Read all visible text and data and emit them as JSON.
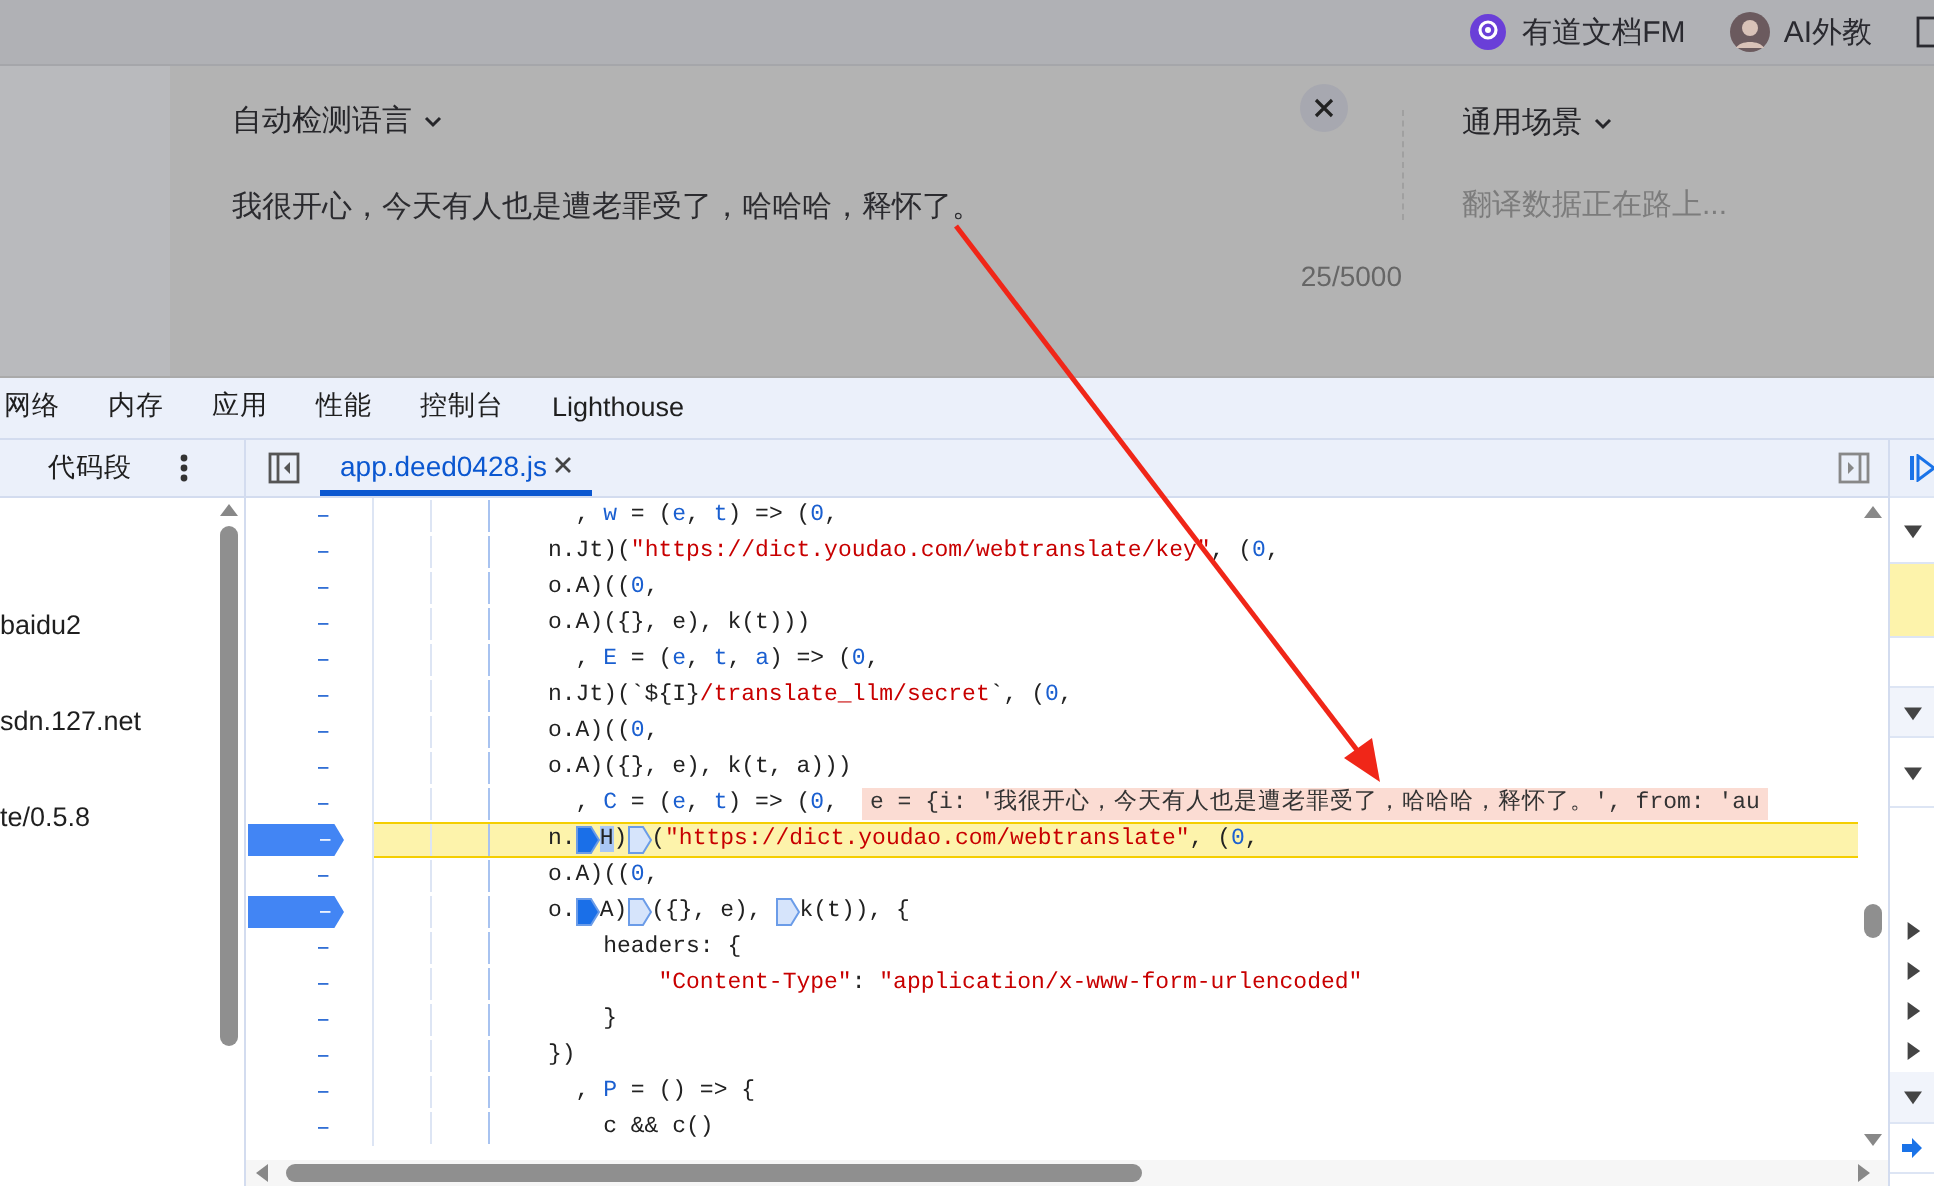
{
  "top_bar": {
    "items": [
      {
        "kind": "fm",
        "label": "有道文档FM"
      },
      {
        "kind": "avatar",
        "label": "AI外教"
      }
    ]
  },
  "translator": {
    "source_language": "自动检测语言",
    "source_text": "我很开心，今天有人也是遭老罪受了，哈哈哈，释怀了。",
    "char_count": "25/5000",
    "scene": "通用场景",
    "placeholder": "翻译数据正在路上..."
  },
  "devtools": {
    "tabs": [
      {
        "label": "网络",
        "selected": false
      },
      {
        "label": "内存",
        "selected": false
      },
      {
        "label": "应用",
        "selected": false
      },
      {
        "label": "性能",
        "selected": false
      },
      {
        "label": "控制台",
        "selected": false
      },
      {
        "label": "Lighthouse",
        "selected": false
      }
    ],
    "sidebar": {
      "title": "代码段",
      "items": [
        "baidu2",
        "sdn.127.net",
        "te/0.5.8"
      ]
    },
    "editor_tab": {
      "label": "app.deed0428.js",
      "selected": true
    },
    "lines": [
      {
        "gutter": "–",
        "breakpoint": false,
        "current": false,
        "tokens": [
          {
            "kind": "plain",
            "text": "  , "
          },
          {
            "kind": "ident",
            "text": "w"
          },
          {
            "kind": "plain",
            "text": " = ("
          },
          {
            "kind": "ident",
            "text": "e"
          },
          {
            "kind": "plain",
            "text": ", "
          },
          {
            "kind": "ident",
            "text": "t"
          },
          {
            "kind": "plain",
            "text": ") => ("
          },
          {
            "kind": "ident",
            "text": "0"
          },
          {
            "kind": "plain",
            "text": ","
          }
        ]
      },
      {
        "gutter": "–",
        "breakpoint": false,
        "current": false,
        "tokens": [
          {
            "kind": "plain",
            "text": "n.Jt)("
          },
          {
            "kind": "string",
            "text": "\"https://dict.youdao.com/webtranslate/key\""
          },
          {
            "kind": "plain",
            "text": ", ("
          },
          {
            "kind": "ident",
            "text": "0"
          },
          {
            "kind": "plain",
            "text": ","
          }
        ]
      },
      {
        "gutter": "–",
        "breakpoint": false,
        "current": false,
        "tokens": [
          {
            "kind": "plain",
            "text": "o.A)(("
          },
          {
            "kind": "ident",
            "text": "0"
          },
          {
            "kind": "plain",
            "text": ","
          }
        ]
      },
      {
        "gutter": "–",
        "breakpoint": false,
        "current": false,
        "tokens": [
          {
            "kind": "plain",
            "text": "o.A)({}, e), k(t)))"
          }
        ]
      },
      {
        "gutter": "–",
        "breakpoint": false,
        "current": false,
        "tokens": [
          {
            "kind": "plain",
            "text": "  , "
          },
          {
            "kind": "ident",
            "text": "E"
          },
          {
            "kind": "plain",
            "text": " = ("
          },
          {
            "kind": "ident",
            "text": "e"
          },
          {
            "kind": "plain",
            "text": ", "
          },
          {
            "kind": "ident",
            "text": "t"
          },
          {
            "kind": "plain",
            "text": ", "
          },
          {
            "kind": "ident",
            "text": "a"
          },
          {
            "kind": "plain",
            "text": ") => ("
          },
          {
            "kind": "ident",
            "text": "0"
          },
          {
            "kind": "plain",
            "text": ","
          }
        ]
      },
      {
        "gutter": "–",
        "breakpoint": false,
        "current": false,
        "tokens": [
          {
            "kind": "plain",
            "text": "n.Jt)(`${I}"
          },
          {
            "kind": "string",
            "text": "/translate_llm/secret"
          },
          {
            "kind": "plain",
            "text": "`, ("
          },
          {
            "kind": "ident",
            "text": "0"
          },
          {
            "kind": "plain",
            "text": ","
          }
        ]
      },
      {
        "gutter": "–",
        "breakpoint": false,
        "current": false,
        "tokens": [
          {
            "kind": "plain",
            "text": "o.A)(("
          },
          {
            "kind": "ident",
            "text": "0"
          },
          {
            "kind": "plain",
            "text": ","
          }
        ]
      },
      {
        "gutter": "–",
        "breakpoint": false,
        "current": false,
        "tokens": [
          {
            "kind": "plain",
            "text": "o.A)({}, e), k(t, a)))"
          }
        ]
      },
      {
        "gutter": "–",
        "breakpoint": false,
        "current": false,
        "tokens": [
          {
            "kind": "plain",
            "text": "  , "
          },
          {
            "kind": "ident",
            "text": "C"
          },
          {
            "kind": "plain",
            "text": " = ("
          },
          {
            "kind": "ident",
            "text": "e"
          },
          {
            "kind": "plain",
            "text": ", "
          },
          {
            "kind": "ident",
            "text": "t"
          },
          {
            "kind": "plain",
            "text": ") => ("
          },
          {
            "kind": "ident",
            "text": "0"
          },
          {
            "kind": "plain",
            "text": ","
          }
        ],
        "inline_value": "e = {i: '我很开心，今天有人也是遭老罪受了，哈哈哈，释怀了。', from: 'au"
      },
      {
        "gutter": "–",
        "breakpoint": true,
        "current": true,
        "tokens": [
          {
            "kind": "plain",
            "text": "n."
          },
          {
            "kind": "marker",
            "filled": true
          },
          {
            "kind": "hit",
            "text": "H"
          },
          {
            "kind": "plain",
            "text": ")"
          },
          {
            "kind": "marker",
            "filled": false
          },
          {
            "kind": "plain",
            "text": "("
          },
          {
            "kind": "string",
            "text": "\"https://dict.youdao.com/webtranslate\""
          },
          {
            "kind": "plain",
            "text": ", ("
          },
          {
            "kind": "ident",
            "text": "0"
          },
          {
            "kind": "plain",
            "text": ","
          }
        ]
      },
      {
        "gutter": "–",
        "breakpoint": false,
        "current": false,
        "tokens": [
          {
            "kind": "plain",
            "text": "o.A)(("
          },
          {
            "kind": "ident",
            "text": "0"
          },
          {
            "kind": "plain",
            "text": ","
          }
        ]
      },
      {
        "gutter": "–",
        "breakpoint": true,
        "current": false,
        "tokens": [
          {
            "kind": "plain",
            "text": "o."
          },
          {
            "kind": "marker",
            "filled": true
          },
          {
            "kind": "plain",
            "text": "A)"
          },
          {
            "kind": "marker",
            "filled": false
          },
          {
            "kind": "plain",
            "text": "({}, e), "
          },
          {
            "kind": "marker",
            "filled": false
          },
          {
            "kind": "plain",
            "text": "k(t)), {"
          }
        ]
      },
      {
        "gutter": "–",
        "breakpoint": false,
        "current": false,
        "tokens": [
          {
            "kind": "plain",
            "text": "    headers: {"
          }
        ]
      },
      {
        "gutter": "–",
        "breakpoint": false,
        "current": false,
        "tokens": [
          {
            "kind": "string",
            "text": "        \"Content-Type\""
          },
          {
            "kind": "plain",
            "text": ": "
          },
          {
            "kind": "string",
            "text": "\"application/x-www-form-urlencoded\""
          }
        ]
      },
      {
        "gutter": "–",
        "breakpoint": false,
        "current": false,
        "tokens": [
          {
            "kind": "plain",
            "text": "    }"
          }
        ]
      },
      {
        "gutter": "–",
        "breakpoint": false,
        "current": false,
        "tokens": [
          {
            "kind": "plain",
            "text": "})"
          }
        ]
      },
      {
        "gutter": "–",
        "breakpoint": false,
        "current": false,
        "tokens": [
          {
            "kind": "plain",
            "text": "  , "
          },
          {
            "kind": "ident",
            "text": "P"
          },
          {
            "kind": "plain",
            "text": " = () => {"
          }
        ]
      },
      {
        "gutter": "–",
        "breakpoint": false,
        "current": false,
        "tokens": [
          {
            "kind": "plain",
            "text": "    c && c()"
          }
        ]
      }
    ]
  }
}
